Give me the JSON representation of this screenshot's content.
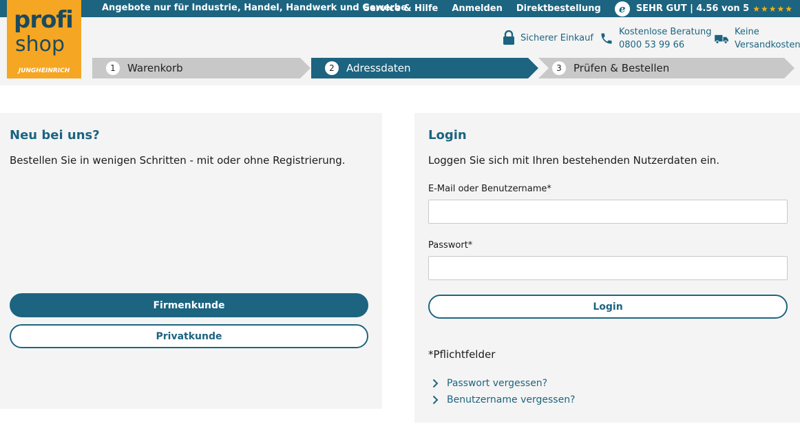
{
  "topbar": {
    "promo": "Angebote nur für Industrie, Handel, Handwerk und Gewerbe.",
    "links": [
      "Service & Hilfe",
      "Anmelden",
      "Direktbestellung"
    ],
    "trusted_badge": "e",
    "rating_text": "SEHR GUT | 4.56 von 5",
    "stars": "★★★★★"
  },
  "logo": {
    "line1": "profi",
    "line2": "shop",
    "brand": "JUNGHEINRICH"
  },
  "usps": {
    "secure": "Sicherer Einkauf",
    "advice_line1": "Kostenlose Beratung",
    "advice_line2": "0800 53 99 66",
    "shipping_line1": "Keine",
    "shipping_line2": "Versandkosten"
  },
  "steps": [
    {
      "num": "1",
      "label": "Warenkorb"
    },
    {
      "num": "2",
      "label": "Adressdaten"
    },
    {
      "num": "3",
      "label": "Prüfen & Bestellen"
    }
  ],
  "new_customer": {
    "title": "Neu bei uns?",
    "text": "Bestellen Sie in wenigen Schritten - mit oder ohne Registrierung.",
    "business_button": "Firmenkunde",
    "private_button": "Privatkunde"
  },
  "login": {
    "title": "Login",
    "text": "Loggen Sie sich mit Ihren bestehenden Nutzerdaten ein.",
    "email_label": "E-Mail oder Benutzername*",
    "email_value": "",
    "password_label": "Passwort*",
    "password_value": "",
    "button": "Login",
    "required_note": "*Pflichtfelder",
    "forgot_password": "Passwort vergessen?",
    "forgot_username": "Benutzername vergessen?"
  },
  "colors": {
    "primary": "#1c6480",
    "accent": "#f5a623",
    "step_inactive": "#c8c8c8",
    "panel_bg": "#f4f4f4"
  }
}
